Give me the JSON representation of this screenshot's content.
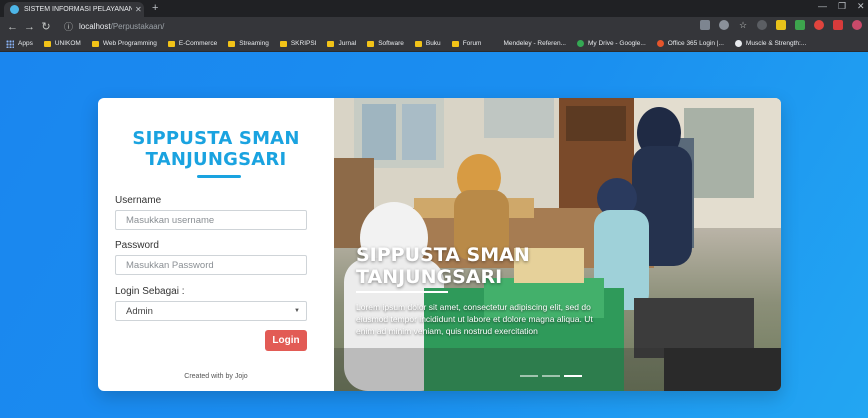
{
  "browser": {
    "tab_title": "SISTEM INFORMASI PELAYANAN",
    "url_host": "localhost",
    "url_path": "/Perpustakaan/",
    "bookmarks": [
      {
        "label": "Apps",
        "kind": "apps"
      },
      {
        "label": "UNIKOM",
        "kind": "folder"
      },
      {
        "label": "Web Programming",
        "kind": "folder"
      },
      {
        "label": "E-Commerce",
        "kind": "folder"
      },
      {
        "label": "Streaming",
        "kind": "folder"
      },
      {
        "label": "SKRIPSI",
        "kind": "folder"
      },
      {
        "label": "Jurnal",
        "kind": "folder"
      },
      {
        "label": "Software",
        "kind": "folder"
      },
      {
        "label": "Buku",
        "kind": "folder"
      },
      {
        "label": "Forum",
        "kind": "folder"
      },
      {
        "label": "Mendeley - Referen...",
        "kind": "plain"
      },
      {
        "label": "My Drive - Google...",
        "kind": "drive"
      },
      {
        "label": "Office 365 Login |...",
        "kind": "office"
      },
      {
        "label": "Muscle & Strength:...",
        "kind": "muscle"
      }
    ]
  },
  "login": {
    "brand_line1": "SIPPUSTA SMAN",
    "brand_line2": "TANJUNGSARI",
    "username_label": "Username",
    "username_placeholder": "Masukkan username",
    "password_label": "Password",
    "password_placeholder": "Masukkan Password",
    "role_label": "Login Sebagai :",
    "role_value": "Admin",
    "login_button": "Login",
    "credit": "Created with by Jojo"
  },
  "carousel": {
    "title_line1": "SIPPUSTA SMAN",
    "title_line2": "TANJUNGSARI",
    "text": "Lorem ipsum dolor sit amet, consectetur adipiscing elit, sed do eiusmod tempor incididunt ut labore et dolore magna aliqua. Ut enim ad minim veniam, quis nostrud exercitation",
    "slide_count": 3,
    "active_slide": 3
  },
  "colors": {
    "page_background": "#1a8ff0",
    "brand": "#1aa3e0",
    "login_button": "#e25b55"
  }
}
